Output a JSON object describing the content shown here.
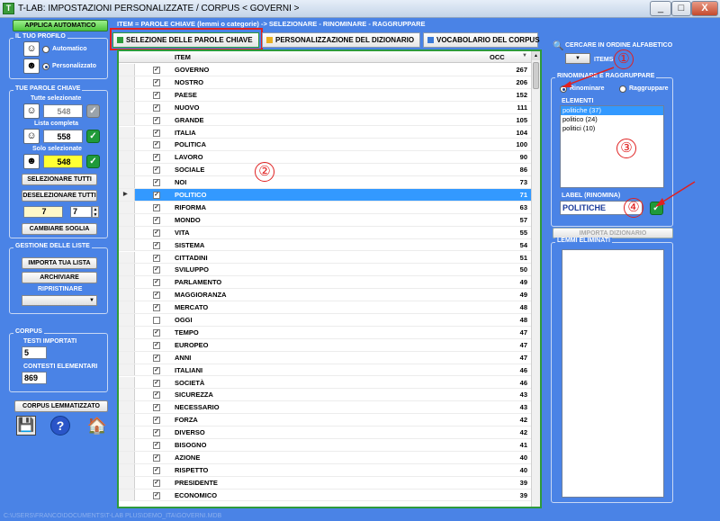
{
  "window": {
    "title": "T-LAB: IMPOSTAZIONI PERSONALIZZATE  /  CORPUS < GOVERNI >",
    "app_icon": "T",
    "controls": [
      "_",
      "□",
      "X"
    ]
  },
  "left": {
    "apply_button": "APPLICA AUTOMATICO",
    "profile": {
      "title": "IL TUO PROFILO",
      "options": [
        {
          "label": "Automatico",
          "selected": false
        },
        {
          "label": "Personalizzato",
          "selected": true
        }
      ]
    },
    "keywords": {
      "title": "TUE PAROLE CHIAVE",
      "all_label": "Tutte selezionate",
      "all_value": "548",
      "complete_label": "Lista completa",
      "complete_value": "558",
      "selected_label": "Solo selezionate",
      "selected_value": "548",
      "select_all": "SELEZIONARE TUTTI",
      "deselect_all": "DESELEZIONARE TUTTI",
      "threshold_a": "7",
      "threshold_b": "7",
      "change_threshold": "CAMBIARE SOGLIA"
    },
    "lists": {
      "title": "GESTIONE DELLE LISTE",
      "import": "IMPORTA TUA LISTA",
      "archive": "ARCHIVIARE",
      "restore_label": "RIPRISTINARE"
    },
    "corpus": {
      "title": "CORPUS",
      "texts_label": "TESTI IMPORTATI",
      "texts_value": "5",
      "contexts_label": "CONTESTI ELEMENTARI",
      "contexts_value": "869"
    },
    "lemmatized": "CORPUS LEMMATIZZATO"
  },
  "header_bar": "ITEM = PAROLE CHIAVE (lemmi o categorie) -> SELEZIONARE - RINOMINARE - RAGGRUPPARE",
  "tabs": [
    {
      "label": "SELEZIONE DELLE PAROLE CHIAVE",
      "color": "#2e9a3b",
      "active": true
    },
    {
      "label": "PERSONALIZZAZIONE DEL DIZIONARIO",
      "color": "#e8b020",
      "active": false
    },
    {
      "label": "VOCABOLARIO DEL CORPUS",
      "color": "#3a7ad8",
      "active": false
    }
  ],
  "grid": {
    "columns": [
      "ITEM",
      "OCC"
    ],
    "rows": [
      {
        "item": "GOVERNO",
        "occ": "267",
        "checked": true
      },
      {
        "item": "NOSTRO",
        "occ": "206",
        "checked": true
      },
      {
        "item": "PAESE",
        "occ": "152",
        "checked": true
      },
      {
        "item": "NUOVO",
        "occ": "111",
        "checked": true
      },
      {
        "item": "GRANDE",
        "occ": "105",
        "checked": true
      },
      {
        "item": "ITALIA",
        "occ": "104",
        "checked": true
      },
      {
        "item": "POLITICA",
        "occ": "100",
        "checked": true
      },
      {
        "item": "LAVORO",
        "occ": "90",
        "checked": true
      },
      {
        "item": "SOCIALE",
        "occ": "86",
        "checked": true
      },
      {
        "item": "NOI",
        "occ": "73",
        "checked": true
      },
      {
        "item": "POLITICO",
        "occ": "71",
        "checked": true,
        "highlighted": true
      },
      {
        "item": "RIFORMA",
        "occ": "63",
        "checked": true
      },
      {
        "item": "MONDO",
        "occ": "57",
        "checked": true
      },
      {
        "item": "VITA",
        "occ": "55",
        "checked": true
      },
      {
        "item": "SISTEMA",
        "occ": "54",
        "checked": true
      },
      {
        "item": "CITTADINI",
        "occ": "51",
        "checked": true
      },
      {
        "item": "SVILUPPO",
        "occ": "50",
        "checked": true
      },
      {
        "item": "PARLAMENTO",
        "occ": "49",
        "checked": true
      },
      {
        "item": "MAGGIORANZA",
        "occ": "49",
        "checked": true
      },
      {
        "item": "MERCATO",
        "occ": "48",
        "checked": true
      },
      {
        "item": "OGGI",
        "occ": "48",
        "checked": false
      },
      {
        "item": "TEMPO",
        "occ": "47",
        "checked": true
      },
      {
        "item": "EUROPEO",
        "occ": "47",
        "checked": true
      },
      {
        "item": "ANNI",
        "occ": "47",
        "checked": true
      },
      {
        "item": "ITALIANI",
        "occ": "46",
        "checked": true
      },
      {
        "item": "SOCIETÀ",
        "occ": "46",
        "checked": true
      },
      {
        "item": "SICUREZZA",
        "occ": "43",
        "checked": true
      },
      {
        "item": "NECESSARIO",
        "occ": "43",
        "checked": true
      },
      {
        "item": "FORZA",
        "occ": "42",
        "checked": true
      },
      {
        "item": "DIVERSO",
        "occ": "42",
        "checked": true
      },
      {
        "item": "BISOGNO",
        "occ": "41",
        "checked": true
      },
      {
        "item": "AZIONE",
        "occ": "40",
        "checked": true
      },
      {
        "item": "RISPETTO",
        "occ": "40",
        "checked": true
      },
      {
        "item": "PRESIDENTE",
        "occ": "39",
        "checked": true
      },
      {
        "item": "ECONOMICO",
        "occ": "39",
        "checked": true
      }
    ]
  },
  "right": {
    "alpha_search": "CERCARE IN ORDINE ALFABETICO",
    "items_label": "ITEMS",
    "rename_group": {
      "title": "RINOMINARE E RAGGRUPPARE",
      "options": [
        {
          "label": "Rinominare",
          "selected": true
        },
        {
          "label": "Raggruppare",
          "selected": false
        }
      ],
      "elements_label": "ELEMENTI",
      "elements": [
        {
          "label": "politiche (37)",
          "selected": true
        },
        {
          "label": "politico (24)",
          "selected": false
        },
        {
          "label": "politici (10)",
          "selected": false
        }
      ],
      "label_title": "LABEL (RINOMINA)",
      "label_value": "POLITICHE"
    },
    "import_dictionary": "IMPORTA DIZIONARIO",
    "removed_lemmas": "LEMMI ELIMINATI"
  },
  "callouts": [
    "①",
    "②",
    "③",
    "④"
  ],
  "status_bar": "C:\\USERS\\FRANCO\\DOCUMENTS\\T-LAB PLUS\\DEMO_ITA\\GOVERNI.MDB"
}
